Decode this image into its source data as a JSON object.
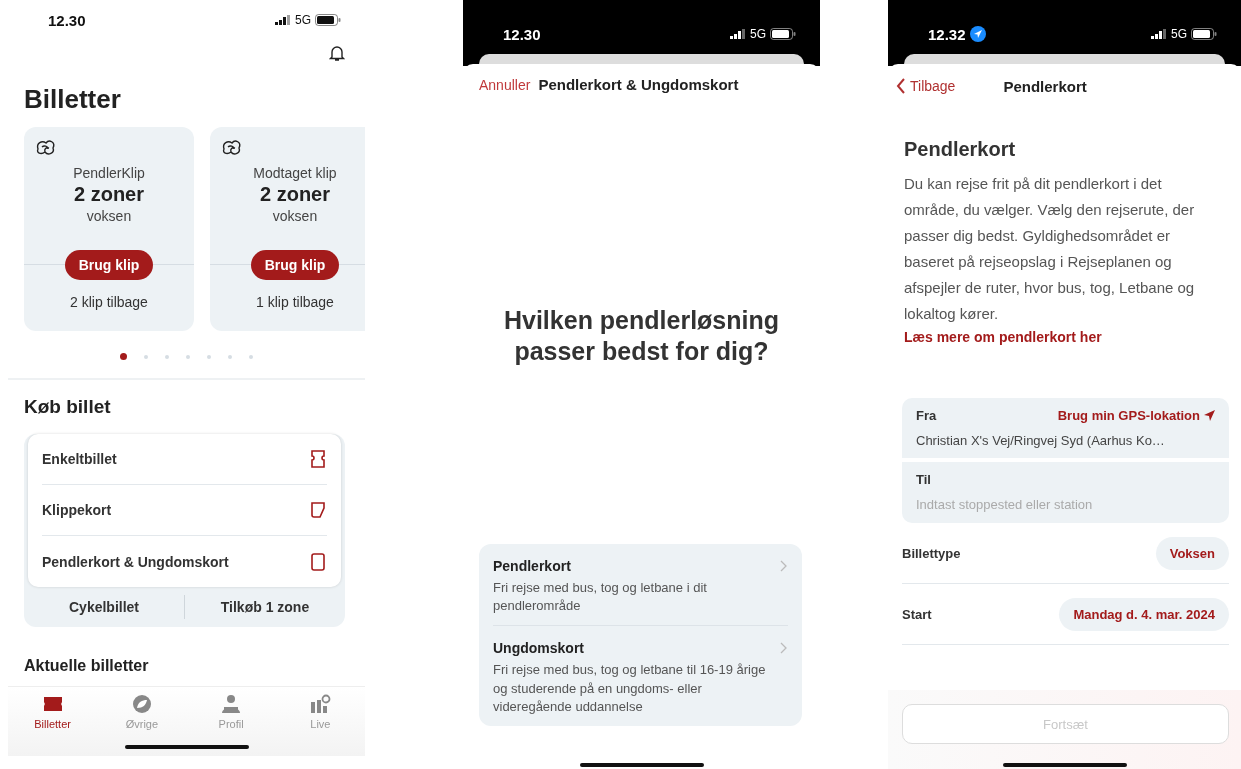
{
  "tickets_screen": {
    "status_bar": {
      "time": "12.30",
      "network": "5G"
    },
    "title": "Billetter",
    "cards": [
      {
        "name": "PendlerKlip",
        "zones": "2 zoner",
        "passenger": "voksen",
        "button": "Brug klip",
        "remaining": "2 klip tilbage"
      },
      {
        "name": "Modtaget klip",
        "zones": "2 zoner",
        "passenger": "voksen",
        "button": "Brug klip",
        "remaining": "1 klip tilbage"
      }
    ],
    "page_dots": [
      {
        "selected": true
      },
      {
        "selected": false
      },
      {
        "selected": false
      },
      {
        "selected": false
      },
      {
        "selected": false
      },
      {
        "selected": false
      },
      {
        "selected": false
      }
    ],
    "buy_title": "Køb billet",
    "buy_options": [
      "Enkeltbillet",
      "Klippekort",
      "Pendlerkort & Ungdomskort"
    ],
    "extra_buttons": [
      "Cykelbillet",
      "Tilkøb 1 zone"
    ],
    "current_title": "Aktuelle billetter",
    "tab_bar": [
      {
        "label": "Billetter",
        "selected": true
      },
      {
        "label": "Øvrige",
        "selected": false
      },
      {
        "label": "Profil",
        "selected": false
      },
      {
        "label": "Live",
        "selected": false
      }
    ]
  },
  "choice_sheet": {
    "status_bar": {
      "time": "12.30",
      "network": "5G"
    },
    "cancel": "Annuller",
    "title": "Pendlerkort & Ungdomskort",
    "question": "Hvilken pendlerløsning passer bedst for dig?",
    "options": [
      {
        "title": "Pendlerkort",
        "description": "Fri rejse med bus, tog og letbane i dit pendlerområde"
      },
      {
        "title": "Ungdomskort",
        "description": "Fri rejse med bus, tog og letbane til 16-19 årige og studerende på en ungdoms- eller videregående uddannelse"
      }
    ]
  },
  "commuter_form": {
    "status_bar": {
      "time": "12.32",
      "network": "5G"
    },
    "back": "Tilbage",
    "title": "Pendlerkort",
    "heading": "Pendlerkort",
    "description": "Du kan rejse frit på dit pendlerkort i det område, du vælger. Vælg den rejserute, der passer dig bedst. Gyldighedsområdet er baseret på rejseopslag i Rejseplanen og afspejler de ruter, hvor bus, tog, Letbane og lokaltog kører.",
    "link": "Læs mere om pendlerkort her",
    "from": {
      "label": "Fra",
      "action": "Brug min GPS-lokation",
      "value": "Christian X's Vej/Ringvej Syd (Aarhus Ko…"
    },
    "to": {
      "label": "Til",
      "placeholder": "Indtast stoppested eller station"
    },
    "rows": [
      {
        "label": "Billettype",
        "value": "Voksen"
      },
      {
        "label": "Start",
        "value": "Mandag d. 4. mar. 2024"
      }
    ],
    "continue": {
      "label": "Fortsæt",
      "disabled": true
    }
  }
}
